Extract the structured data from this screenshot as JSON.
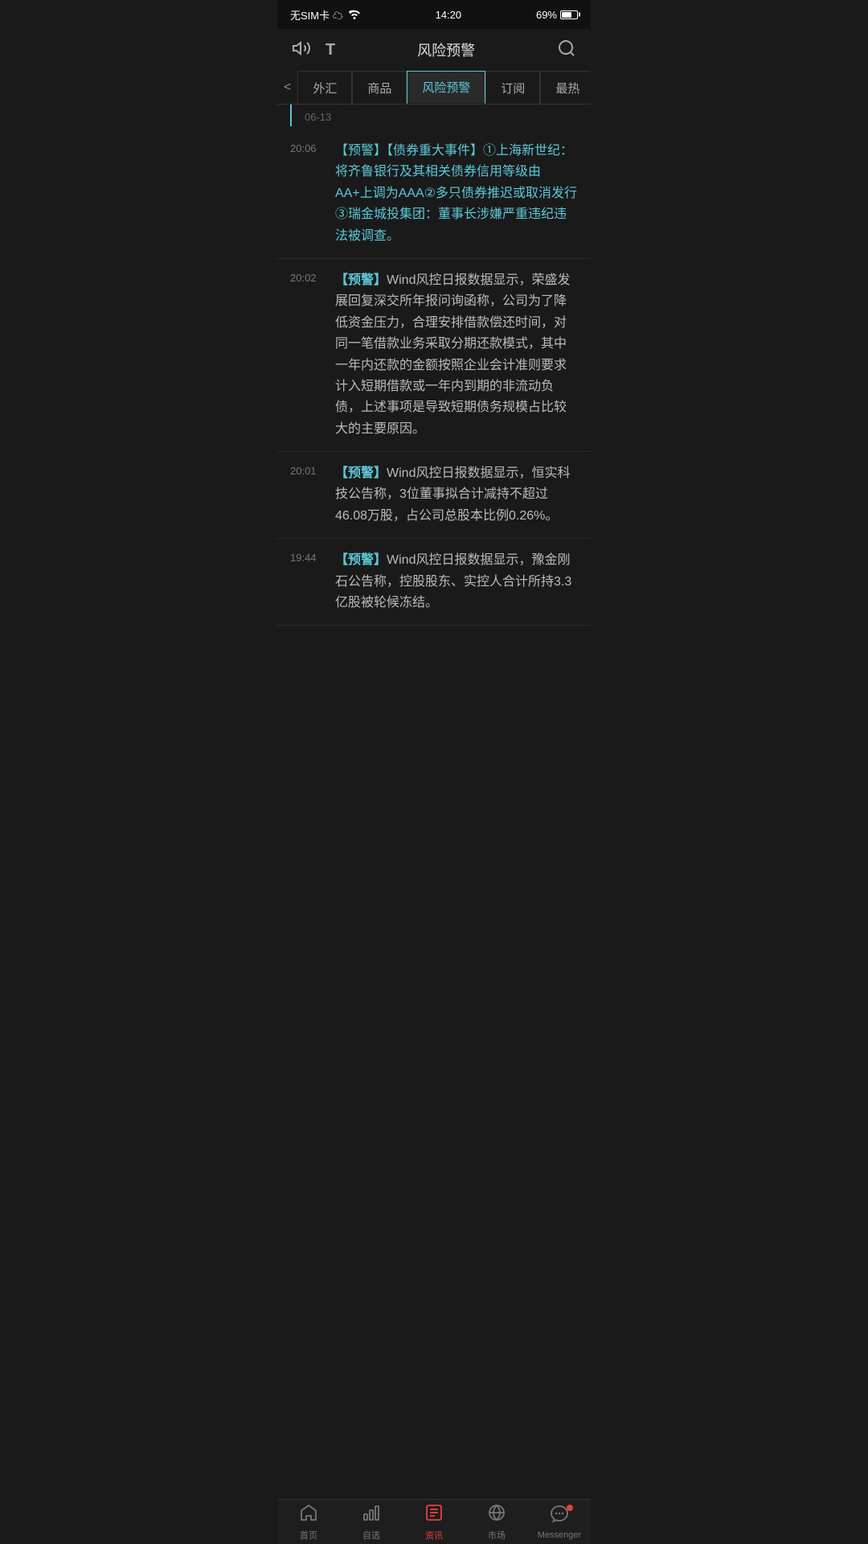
{
  "statusBar": {
    "left": "无SIM卡 ☁",
    "time": "14:20",
    "battery": "69%"
  },
  "appBar": {
    "title": "风险预警",
    "soundIcon": "🔊",
    "fontIcon": "T",
    "searchIcon": "🔍"
  },
  "tabs": [
    {
      "id": "forex",
      "label": "外汇",
      "active": false
    },
    {
      "id": "commodity",
      "label": "商品",
      "active": false
    },
    {
      "id": "risk",
      "label": "风险预警",
      "active": true
    },
    {
      "id": "subscribe",
      "label": "订阅",
      "active": false
    },
    {
      "id": "hot",
      "label": "最热",
      "active": false
    }
  ],
  "dateGroup": "06-13",
  "newsItems": [
    {
      "time": "20:06",
      "highlight": true,
      "content": "【预警】【债券重大事件】①上海新世纪：将齐鲁银行及其相关债券信用等级由AA+上调为AAA②多只债券推迟或取消发行③瑞金城投集团：董事长涉嫌严重违纪违法被调查。"
    },
    {
      "time": "20:02",
      "highlight": false,
      "content": "【预警】Wind风控日报数据显示，荣盛发展回复深交所年报问询函称，公司为了降低资金压力，合理安排借款偿还时间，对同一笔借款业务采取分期还款模式，其中一年内还款的金额按照企业会计准则要求计入短期借款或一年内到期的非流动负债，上述事项是导致短期债务规模占比较大的主要原因。"
    },
    {
      "time": "20:01",
      "highlight": false,
      "content": "【预警】Wind风控日报数据显示，恒实科技公告称，3位董事拟合计减持不超过46.08万股，占公司总股本比例0.26%。"
    },
    {
      "time": "19:44",
      "highlight": false,
      "content": "【预警】Wind风控日报数据显示，豫金刚石公告称，控股股东、实控人合计所持3.3亿股被轮候冻结。"
    }
  ],
  "bottomNav": [
    {
      "id": "home",
      "icon": "home",
      "label": "首页",
      "active": false
    },
    {
      "id": "watchlist",
      "icon": "chart",
      "label": "自选",
      "active": false
    },
    {
      "id": "news",
      "icon": "news",
      "label": "资讯",
      "active": true
    },
    {
      "id": "market",
      "icon": "globe",
      "label": "市场",
      "active": false
    },
    {
      "id": "messenger",
      "icon": "star",
      "label": "Messenger",
      "active": false,
      "badge": true
    }
  ]
}
